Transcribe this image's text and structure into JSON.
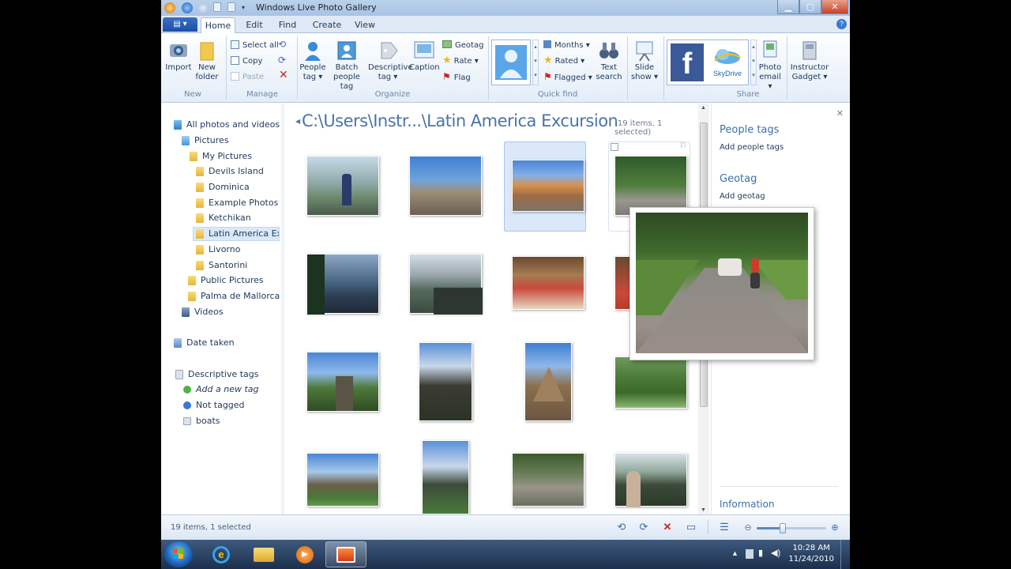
{
  "window": {
    "title": "Windows Live Photo Gallery"
  },
  "tabs": [
    {
      "label": "Home",
      "active": true
    },
    {
      "label": "Edit",
      "active": false
    },
    {
      "label": "Find",
      "active": false
    },
    {
      "label": "Create",
      "active": false
    },
    {
      "label": "View",
      "active": false
    }
  ],
  "ribbon": {
    "import": "Import",
    "new_folder_1": "New",
    "new_folder_2": "folder",
    "group_new": "New",
    "select_all": "Select all",
    "copy": "Copy",
    "paste": "Paste",
    "group_manage": "Manage",
    "people_tag_1": "People",
    "people_tag_2": "tag",
    "batch_1": "Batch",
    "batch_2": "people tag",
    "desc_1": "Descriptive",
    "desc_2": "tag",
    "caption": "Caption",
    "geotag": "Geotag",
    "rate": "Rate",
    "flag": "Flag",
    "group_organize": "Organize",
    "months": "Months",
    "rated": "Rated",
    "flagged": "Flagged",
    "text_search_1": "Text",
    "text_search_2": "search",
    "group_quickfind": "Quick find",
    "slide_1": "Slide",
    "slide_2": "show",
    "skydrive": "SkyDrive",
    "photo_email_1": "Photo",
    "photo_email_2": "email",
    "gadget_1": "Instructor",
    "gadget_2": "Gadget",
    "group_share": "Share"
  },
  "nav": {
    "all": "All photos and videos",
    "pictures": "Pictures",
    "my_pictures": "My Pictures",
    "folders": [
      "Devils Island",
      "Dominica",
      "Example Photos",
      "Ketchikan",
      "Latin America Excur",
      "Livorno",
      "Santorini"
    ],
    "public_pictures": "Public Pictures",
    "palma": "Palma de Mallorca",
    "videos": "Videos",
    "date_taken": "Date taken",
    "descriptive_tags": "Descriptive tags",
    "add_tag": "Add a new tag",
    "not_tagged": "Not tagged",
    "boats": "boats"
  },
  "content": {
    "path": "C:\\Users\\Instr...\\Latin America Excursion",
    "count": "(19 items, 1 selected)"
  },
  "rpane": {
    "people_tags": "People tags",
    "add_people_tags": "Add people tags",
    "geotag": "Geotag",
    "add_geotag": "Add geotag",
    "information": "Information"
  },
  "status": {
    "text": "19 items, 1 selected",
    "zoom": 0.38
  },
  "taskbar": {
    "time": "10:28 AM",
    "date": "11/24/2010"
  }
}
